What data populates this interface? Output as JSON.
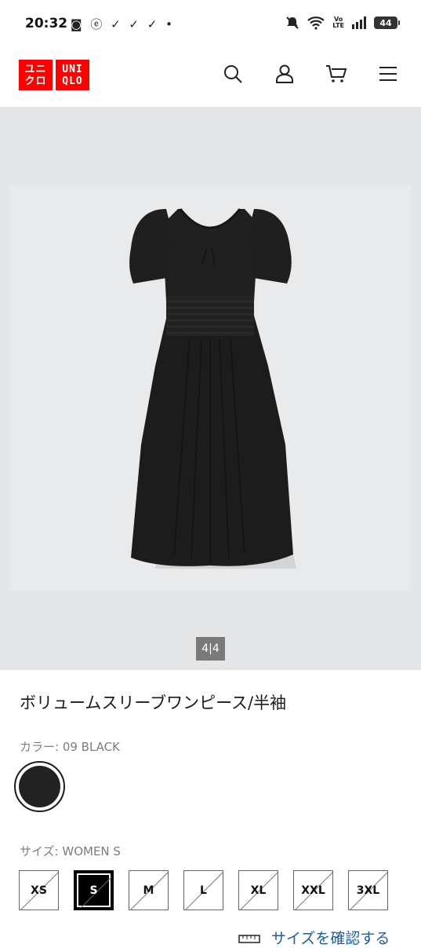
{
  "status_bar": {
    "time": "20:32",
    "left_icons": "◙ ⓔ ✓ ✓ ✓ •",
    "volte_top": "Vo",
    "volte_bottom": "LTE",
    "battery": "44"
  },
  "header": {
    "logo_left": [
      "ユニ",
      "クロ"
    ],
    "logo_right": [
      "UNI",
      "QLO"
    ],
    "icons": [
      "search-icon",
      "account-icon",
      "cart-icon",
      "menu-icon"
    ]
  },
  "gallery": {
    "counter": "4|4",
    "image_alt": "black dress photo"
  },
  "product": {
    "title": "ボリュームスリーブワンピース/半袖",
    "color_label": "カラー: ",
    "color_value": "09 BLACK",
    "size_label": "サイズ: ",
    "size_value": "WOMEN S",
    "sizes": [
      "XS",
      "S",
      "M",
      "L",
      "XL",
      "XXL",
      "3XL"
    ],
    "selected_size": "S",
    "size_check_label": "サイズを確認する"
  },
  "colors": {
    "brand_red": "#ff0000",
    "link_blue": "#1a5dab",
    "gallery_bg": "#e5e6e8"
  }
}
